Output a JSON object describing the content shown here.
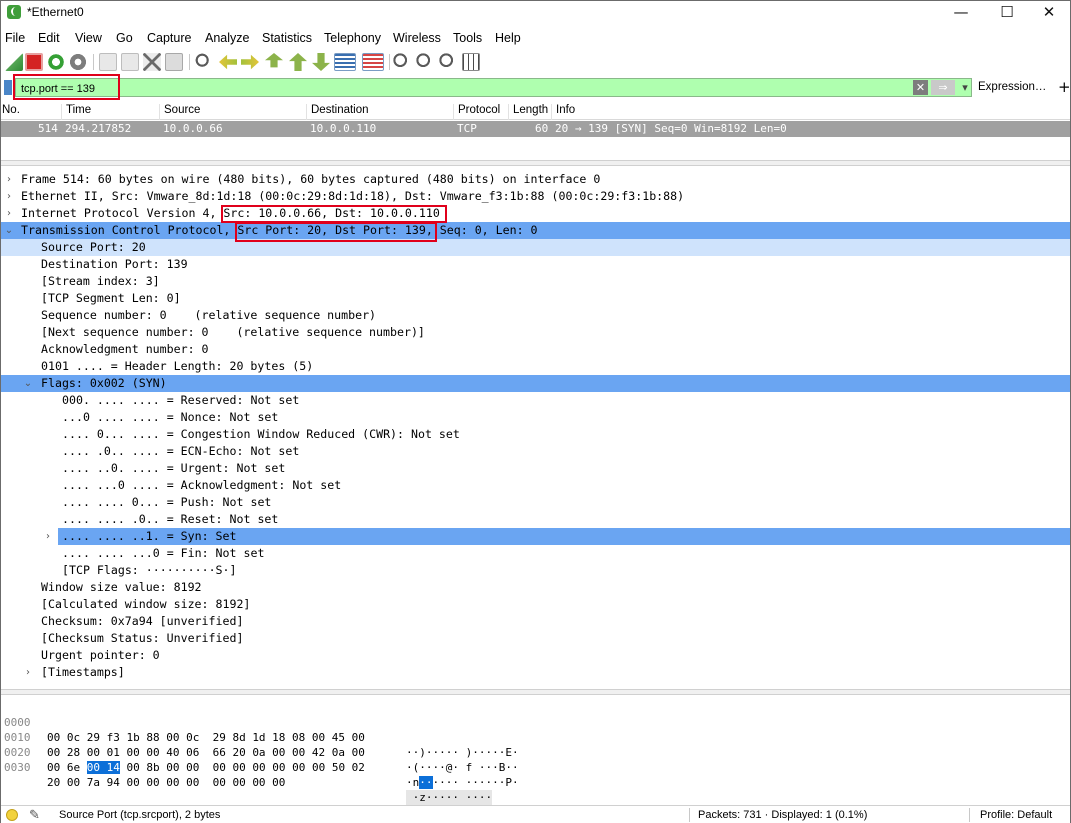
{
  "window": {
    "title": "*Ethernet0",
    "controls": {
      "minimize": "—",
      "maximize": "☐",
      "close": "✕"
    }
  },
  "menu": [
    "File",
    "Edit",
    "View",
    "Go",
    "Capture",
    "Analyze",
    "Statistics",
    "Telephony",
    "Wireless",
    "Tools",
    "Help"
  ],
  "toolbar": {
    "buttons": [
      "shark-fin-start-icon",
      "stop-square-icon",
      "restart-icon",
      "options-gear-icon",
      "open-file-icon",
      "save-file-icon",
      "close-file-icon",
      "reload-icon",
      "find-icon",
      "go-back-icon",
      "go-forward-icon",
      "go-to-packet-icon",
      "go-first-icon",
      "go-last-icon",
      "autoscroll-icon",
      "colorize-icon",
      "zoom-in-icon",
      "zoom-out-icon",
      "zoom-normal-icon",
      "resize-columns-icon"
    ]
  },
  "filter": {
    "value": "tcp.port == 139",
    "expression_label": "Expression…",
    "plus_label": "+"
  },
  "packet_list": {
    "columns": [
      "No.",
      "Time",
      "Source",
      "Destination",
      "Protocol",
      "Length",
      "Info"
    ],
    "rows": [
      {
        "no": "514",
        "time": "294.217852",
        "source": "10.0.0.66",
        "destination": "10.0.0.110",
        "protocol": "TCP",
        "length": "60",
        "info": "20 → 139 [SYN] Seq=0 Win=8192 Len=0"
      }
    ]
  },
  "details": [
    {
      "indent": 0,
      "arrow": "›",
      "text": "Frame 514: 60 bytes on wire (480 bits), 60 bytes captured (480 bits) on interface 0",
      "style": ""
    },
    {
      "indent": 0,
      "arrow": "›",
      "text": "Ethernet II, Src: Vmware_8d:1d:18 (00:0c:29:8d:1d:18), Dst: Vmware_f3:1b:88 (00:0c:29:f3:1b:88)",
      "style": ""
    },
    {
      "indent": 0,
      "arrow": "›",
      "text": "Internet Protocol Version 4, Src: 10.0.0.66, Dst: 10.0.0.110",
      "style": ""
    },
    {
      "indent": 0,
      "arrow": "⌄",
      "text": "Transmission Control Protocol, Src Port: 20, Dst Port: 139, Seq: 0, Len: 0",
      "style": "hl"
    },
    {
      "indent": 1,
      "arrow": "",
      "text": "Source Port: 20",
      "style": "sub"
    },
    {
      "indent": 1,
      "arrow": "",
      "text": "Destination Port: 139",
      "style": ""
    },
    {
      "indent": 1,
      "arrow": "",
      "text": "[Stream index: 3]",
      "style": ""
    },
    {
      "indent": 1,
      "arrow": "",
      "text": "[TCP Segment Len: 0]",
      "style": ""
    },
    {
      "indent": 1,
      "arrow": "",
      "text": "Sequence number: 0    (relative sequence number)",
      "style": ""
    },
    {
      "indent": 1,
      "arrow": "",
      "text": "[Next sequence number: 0    (relative sequence number)]",
      "style": ""
    },
    {
      "indent": 1,
      "arrow": "",
      "text": "Acknowledgment number: 0",
      "style": ""
    },
    {
      "indent": 1,
      "arrow": "",
      "text": "0101 .... = Header Length: 20 bytes (5)",
      "style": ""
    },
    {
      "indent": 1,
      "arrow": "⌄",
      "text": "Flags: 0x002 (SYN)",
      "style": "hl"
    },
    {
      "indent": 2,
      "arrow": "",
      "text": "000. .... .... = Reserved: Not set",
      "style": ""
    },
    {
      "indent": 2,
      "arrow": "",
      "text": "...0 .... .... = Nonce: Not set",
      "style": ""
    },
    {
      "indent": 2,
      "arrow": "",
      "text": ".... 0... .... = Congestion Window Reduced (CWR): Not set",
      "style": ""
    },
    {
      "indent": 2,
      "arrow": "",
      "text": ".... .0.. .... = ECN-Echo: Not set",
      "style": ""
    },
    {
      "indent": 2,
      "arrow": "",
      "text": ".... ..0. .... = Urgent: Not set",
      "style": ""
    },
    {
      "indent": 2,
      "arrow": "",
      "text": ".... ...0 .... = Acknowledgment: Not set",
      "style": ""
    },
    {
      "indent": 2,
      "arrow": "",
      "text": ".... .... 0... = Push: Not set",
      "style": ""
    },
    {
      "indent": 2,
      "arrow": "",
      "text": ".... .... .0.. = Reset: Not set",
      "style": ""
    },
    {
      "indent": 2,
      "arrow": "›",
      "text": ".... .... ..1. = Syn: Set",
      "style": "hl"
    },
    {
      "indent": 2,
      "arrow": "",
      "text": ".... .... ...0 = Fin: Not set",
      "style": ""
    },
    {
      "indent": 2,
      "arrow": "",
      "text": "[TCP Flags: ··········S·]",
      "style": ""
    },
    {
      "indent": 1,
      "arrow": "",
      "text": "Window size value: 8192",
      "style": ""
    },
    {
      "indent": 1,
      "arrow": "",
      "text": "[Calculated window size: 8192]",
      "style": ""
    },
    {
      "indent": 1,
      "arrow": "",
      "text": "Checksum: 0x7a94 [unverified]",
      "style": ""
    },
    {
      "indent": 1,
      "arrow": "",
      "text": "[Checksum Status: Unverified]",
      "style": ""
    },
    {
      "indent": 1,
      "arrow": "",
      "text": "Urgent pointer: 0",
      "style": ""
    },
    {
      "indent": 1,
      "arrow": "›",
      "text": "[Timestamps]",
      "style": ""
    }
  ],
  "hex_dump": [
    {
      "offset": "0000",
      "bytes_a": "00 0c 29 f3 1b 88 00 0c",
      "bytes_b": "29 8d 1d 18 08 00 45 00",
      "ascii": "··)····· )·····E·"
    },
    {
      "offset": "0010",
      "bytes_a": "00 28 00 01 00 00 40 06",
      "bytes_b": "66 20 0a 00 00 42 0a 00",
      "ascii": "·(····@· f ···B··"
    },
    {
      "offset": "0020",
      "bytes_a_pre": "00 6e ",
      "bytes_a_sel": "00 14",
      "bytes_a_post": " 00 8b 00 00",
      "bytes_b": "00 00 00 00 00 00 50 02",
      "ascii_pre": "·n",
      "ascii_sel": "··",
      "ascii_post": "···· ······P·"
    },
    {
      "offset": "0030",
      "bytes_a": "20 00 7a 94 00 00 00 00",
      "bytes_b": "00 00 00 00",
      "ascii": " ·z····· ····"
    }
  ],
  "status": {
    "field": "Source Port (tcp.srcport), 2 bytes",
    "packets": "Packets: 731 · Displayed: 1 (0.1%)",
    "profile": "Profile: Default"
  },
  "colors": {
    "filter_valid": "#afffaf",
    "selection": "#6aa5f2",
    "annotation_red": "#e0001b",
    "packet_row": "#a0a0a0"
  }
}
